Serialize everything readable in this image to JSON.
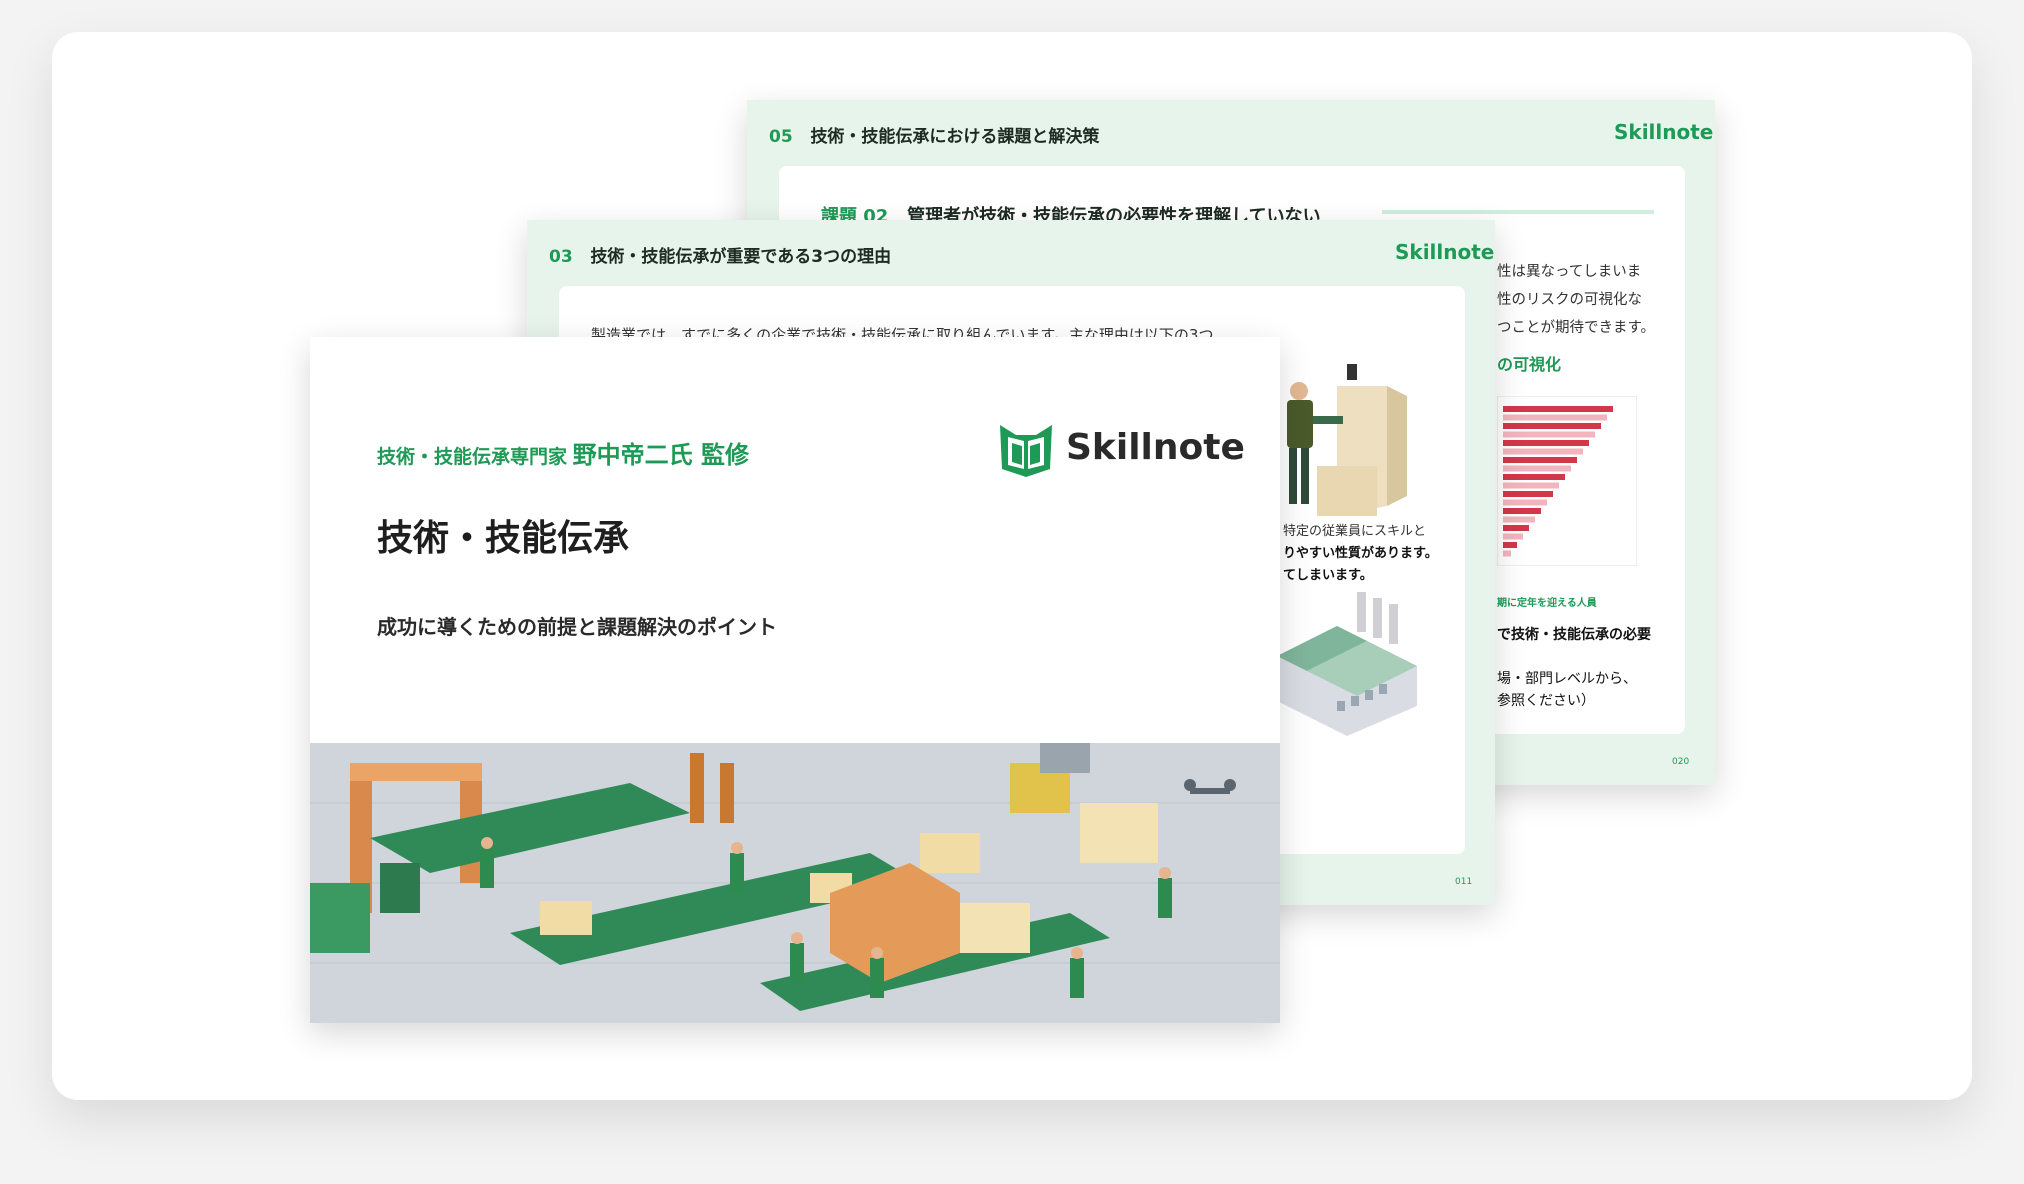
{
  "back_page": {
    "section_number": "05",
    "section_title": "技術・技能伝承における課題と解決策",
    "brand": "Skillnote",
    "task_label": "課題",
    "task_number": "02",
    "task_title": "管理者が技術・技能伝承の必要性を理解していない",
    "lines": [
      "性は異なってしまいま",
      "性のリスクの可視化な",
      "つことが期待できます。"
    ],
    "sub_heading": "の可視化",
    "caption": "期に定年を迎える人員",
    "line_bold": "で技術・技能伝承の必要",
    "lines2": [
      "場・部門レベルから、",
      "参照ください）"
    ],
    "page_number": "020"
  },
  "mid_page": {
    "section_number": "03",
    "section_title": "技術・技能伝承が重要である3つの理由",
    "brand": "Skillnote",
    "intro": "製造業では、すでに多くの企業で技術・技能伝承に取り組んでいます。主な理由は以下の3つ",
    "lines": [
      "特定の従業員にスキルと",
      "りやすい性質があります。",
      "てしまいます。"
    ],
    "page_number": "011"
  },
  "front_page": {
    "supervisor_prefix": "技術・技能伝承専門家",
    "supervisor_name": "野中帝二氏 監修",
    "brand": "Skillnote",
    "title": "技術・技能伝承",
    "subtitle": "成功に導くための前提と課題解決のポイント"
  },
  "colors": {
    "brand_green": "#1d9a55",
    "pale_green": "#e6f4ec",
    "chart_red": "#d2374a"
  }
}
